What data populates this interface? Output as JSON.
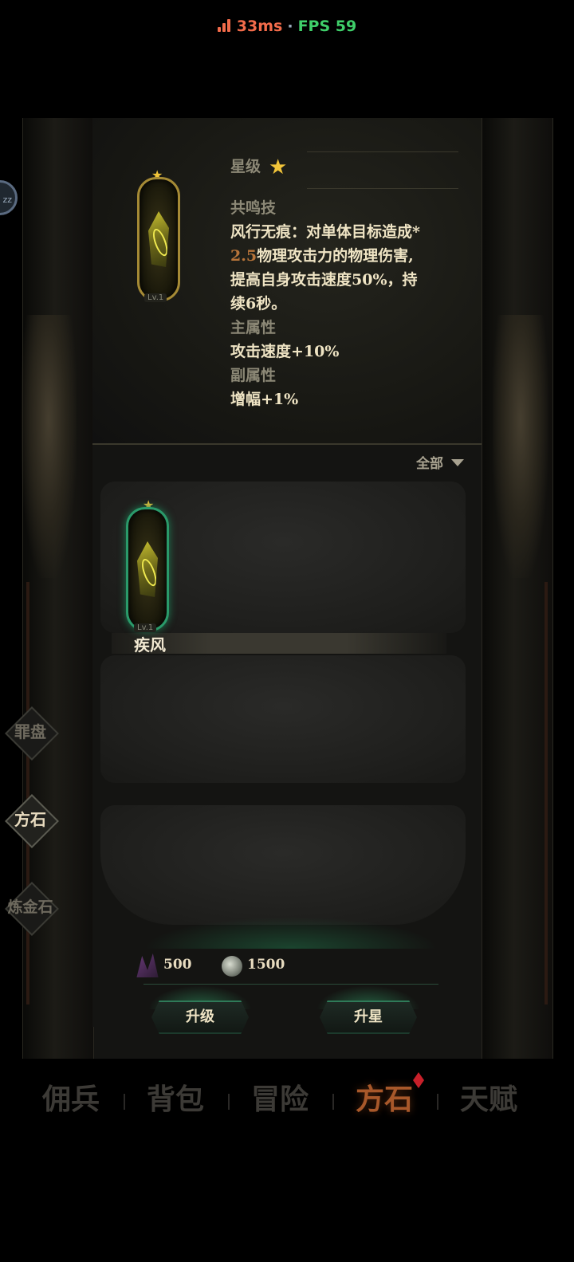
{
  "status": {
    "ping": "33ms",
    "separator": "·",
    "fps": "FPS 59",
    "colors": {
      "ping": "#f26b4a",
      "fps": "#3fcf6a"
    }
  },
  "floating_badge": "zz",
  "detail": {
    "star_label": "星级",
    "star_icon": "★",
    "gem_level": "Lv.1",
    "resonance_label": "共鸣技",
    "skill_line1": "风行无痕：对单体目标造成*",
    "skill_num": "2.5",
    "skill_line2": "物理攻击力的物理伤害,",
    "skill_line3": "提高自身攻击速度50%，持",
    "skill_line4": "续6秒。",
    "main_attr_label": "主属性",
    "main_attr_value": "攻击速度+10%",
    "sub_attr_label": "副属性",
    "sub_attr_value": "增幅+1%"
  },
  "list": {
    "filter": "全部",
    "items": [
      {
        "name": "疾风",
        "level": "Lv.1",
        "stars": "★",
        "selected": true
      }
    ]
  },
  "costs": [
    {
      "icon": "crystal-icon",
      "value": "500"
    },
    {
      "icon": "coin-icon",
      "value": "1500"
    }
  ],
  "buttons": {
    "upgrade": "升级",
    "star_up": "升星"
  },
  "side_tabs": [
    {
      "label": "罪盘",
      "active": false
    },
    {
      "label": "方石",
      "active": true
    },
    {
      "label": "炼金石",
      "active": false
    }
  ],
  "bottom_nav": [
    {
      "label": "佣兵",
      "active": false
    },
    {
      "label": "背包",
      "active": false
    },
    {
      "label": "冒险",
      "active": false
    },
    {
      "label": "方石",
      "active": true
    },
    {
      "label": "天赋",
      "active": false
    }
  ]
}
